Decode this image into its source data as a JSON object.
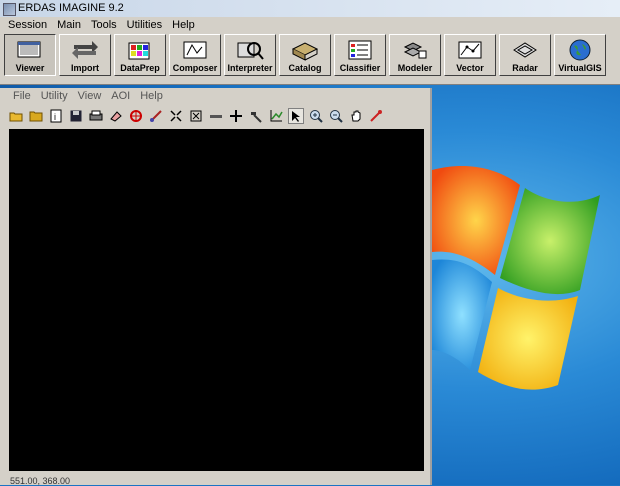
{
  "window": {
    "title": "ERDAS IMAGINE 9.2"
  },
  "menubar": {
    "items": [
      "Session",
      "Main",
      "Tools",
      "Utilities",
      "Help"
    ]
  },
  "toolbar": {
    "buttons": [
      {
        "label": "Viewer",
        "icon": "viewer-icon",
        "pressed": true
      },
      {
        "label": "Import",
        "icon": "import-icon"
      },
      {
        "label": "DataPrep",
        "icon": "dataprep-icon"
      },
      {
        "label": "Composer",
        "icon": "composer-icon"
      },
      {
        "label": "Interpreter",
        "icon": "interpreter-icon"
      },
      {
        "label": "Catalog",
        "icon": "catalog-icon"
      },
      {
        "label": "Classifier",
        "icon": "classifier-icon"
      },
      {
        "label": "Modeler",
        "icon": "modeler-icon"
      },
      {
        "label": "Vector",
        "icon": "vector-icon"
      },
      {
        "label": "Radar",
        "icon": "radar-icon"
      },
      {
        "label": "VirtualGIS",
        "icon": "globe-icon"
      }
    ]
  },
  "viewer": {
    "menubar": {
      "items": [
        "File",
        "Utility",
        "View",
        "AOI",
        "Help"
      ]
    },
    "status": "551.00, 368.00"
  },
  "colors": {
    "window_bg": "#d4d0c8",
    "canvas_bg": "#000000",
    "desktop_blue": "#1a74c4"
  }
}
